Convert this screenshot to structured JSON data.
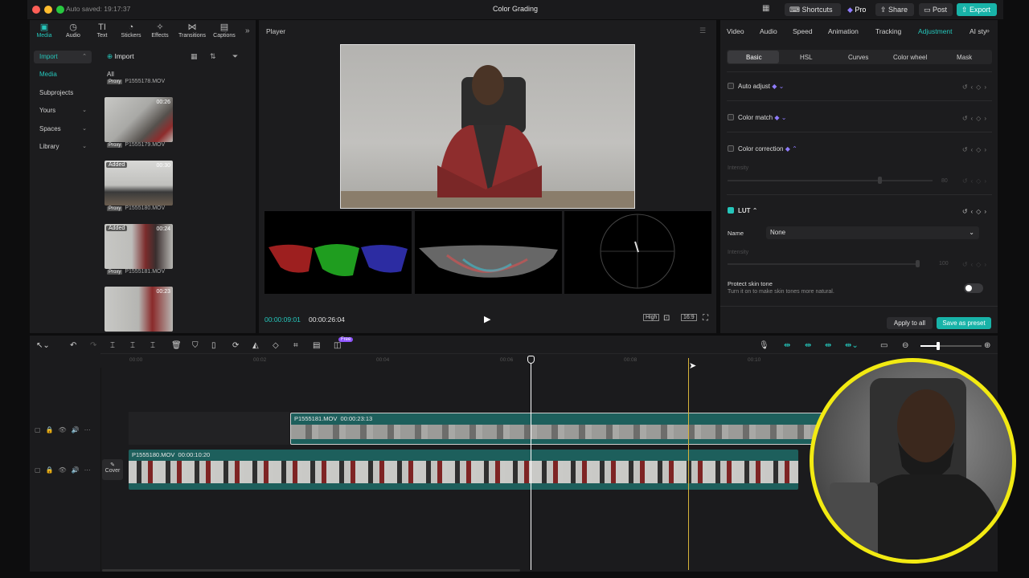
{
  "window": {
    "autosave": "Auto saved: 19:17:37",
    "title": "Color Grading",
    "buttons": {
      "shortcuts": "Shortcuts",
      "pro": "Pro",
      "share": "Share",
      "post": "Post",
      "export": "Export"
    }
  },
  "left_tabs": [
    {
      "label": "Media",
      "icon": "media-icon"
    },
    {
      "label": "Audio",
      "icon": "audio-icon"
    },
    {
      "label": "Text",
      "icon": "text-icon"
    },
    {
      "label": "Stickers",
      "icon": "stickers-icon"
    },
    {
      "label": "Effects",
      "icon": "effects-icon"
    },
    {
      "label": "Transitions",
      "icon": "transitions-icon"
    },
    {
      "label": "Captions",
      "icon": "captions-icon"
    }
  ],
  "sidebar": {
    "items": [
      "Import",
      "Media",
      "Subprojects",
      "Yours",
      "Spaces",
      "Library"
    ],
    "import_button": "Import",
    "all_label": "All"
  },
  "media": [
    {
      "name": "P1555178.MOV",
      "duration": "",
      "added": ""
    },
    {
      "name": "P1555179.MOV",
      "duration": "00:26",
      "added": ""
    },
    {
      "name": "P1555180.MOV",
      "duration": "00:30",
      "added": "Added"
    },
    {
      "name": "P1555181.MOV",
      "duration": "00:24",
      "added": "Added"
    },
    {
      "name": "",
      "duration": "00:23",
      "added": ""
    }
  ],
  "proxy_label": "Proxy",
  "player": {
    "title": "Player",
    "current_time": "00:00:09:01",
    "total_time": "00:00:26:04",
    "quality": "High",
    "ratio": "16:9"
  },
  "right_tabs": [
    "Video",
    "Audio",
    "Speed",
    "Animation",
    "Tracking",
    "Adjustment",
    "AI sty"
  ],
  "subtabs": [
    "Basic",
    "HSL",
    "Curves",
    "Color wheel",
    "Mask"
  ],
  "adjust": {
    "auto_adjust": "Auto adjust",
    "color_match": "Color match",
    "color_correction": "Color correction",
    "intensity": "Intensity",
    "cc_value": "80",
    "lut": "LUT",
    "name_label": "Name",
    "name_value": "None",
    "lut_value": "100",
    "protect_title": "Protect skin tone",
    "protect_desc": "Turn it on to make skin tones more natural.",
    "apply_all": "Apply to all",
    "save_preset": "Save as preset"
  },
  "timeline": {
    "ruler": [
      "00:00",
      "00:02",
      "00:04",
      "00:06",
      "00:08",
      "00:10"
    ],
    "free_badge": "Free",
    "clip_top": {
      "name": "P1555181.MOV",
      "duration": "00:00:23:13"
    },
    "clip_main": {
      "name": "P1555180.MOV",
      "duration": "00:00:10:20"
    },
    "cover": "Cover"
  },
  "colors": {
    "accent": "#25c6bb",
    "playhead": "#ffffff",
    "hover_line": "#d6b43a",
    "cam_ring": "#f2ea12"
  }
}
